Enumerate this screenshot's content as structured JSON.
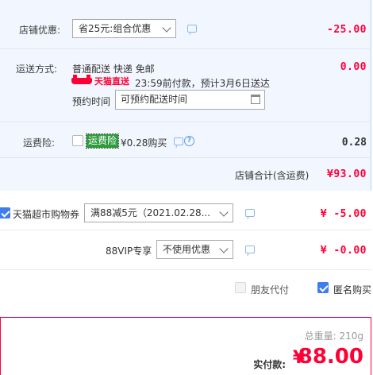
{
  "shop_discount": {
    "label": "店铺优惠:",
    "selected": "省25元:组合优惠",
    "amount": "-25.00"
  },
  "delivery": {
    "label": "运送方式:",
    "method": "普通配送 快递 免邮",
    "amount": "0.00",
    "tmall_badge": "天猫直送",
    "eta_text": "23:59前付款，预计3月6日送达",
    "schedule_label": "预约时间",
    "schedule_placeholder": "可预约配送时间"
  },
  "shipping_insurance": {
    "label": "运费险:",
    "tag": "运费险",
    "price_text": "¥0.28购买",
    "amount": "0.28",
    "checked": false
  },
  "shop_total": {
    "label": "店铺合计(含运费)",
    "amount": "¥93.00"
  },
  "supermarket_coupon": {
    "label": "天猫超市购物券",
    "checked": true,
    "selected": "满88减5元（2021.02.28...",
    "amount": "¥ -5.00"
  },
  "vip88": {
    "label": "88VIP专享",
    "selected": "不使用优惠",
    "amount": "¥ -0.00"
  },
  "options": {
    "friend_pay_label": "朋友代付",
    "friend_pay_checked": false,
    "anonymous_label": "匿名购买",
    "anonymous_checked": true
  },
  "summary": {
    "weight_text": "总重量:  210g",
    "pay_label": "实付款:",
    "currency_symbol": "¥",
    "pay_amount": "88.00"
  },
  "icons": {
    "message": "message-icon",
    "help": "help-icon",
    "calendar": "calendar-icon",
    "dropdown": "chevron-down-icon"
  },
  "colors": {
    "accent_red": "#ff0036",
    "panel_bg": "#f2f7ff",
    "checkbox_blue": "#3d7df0",
    "insurance_green": "#2e9b3c"
  }
}
